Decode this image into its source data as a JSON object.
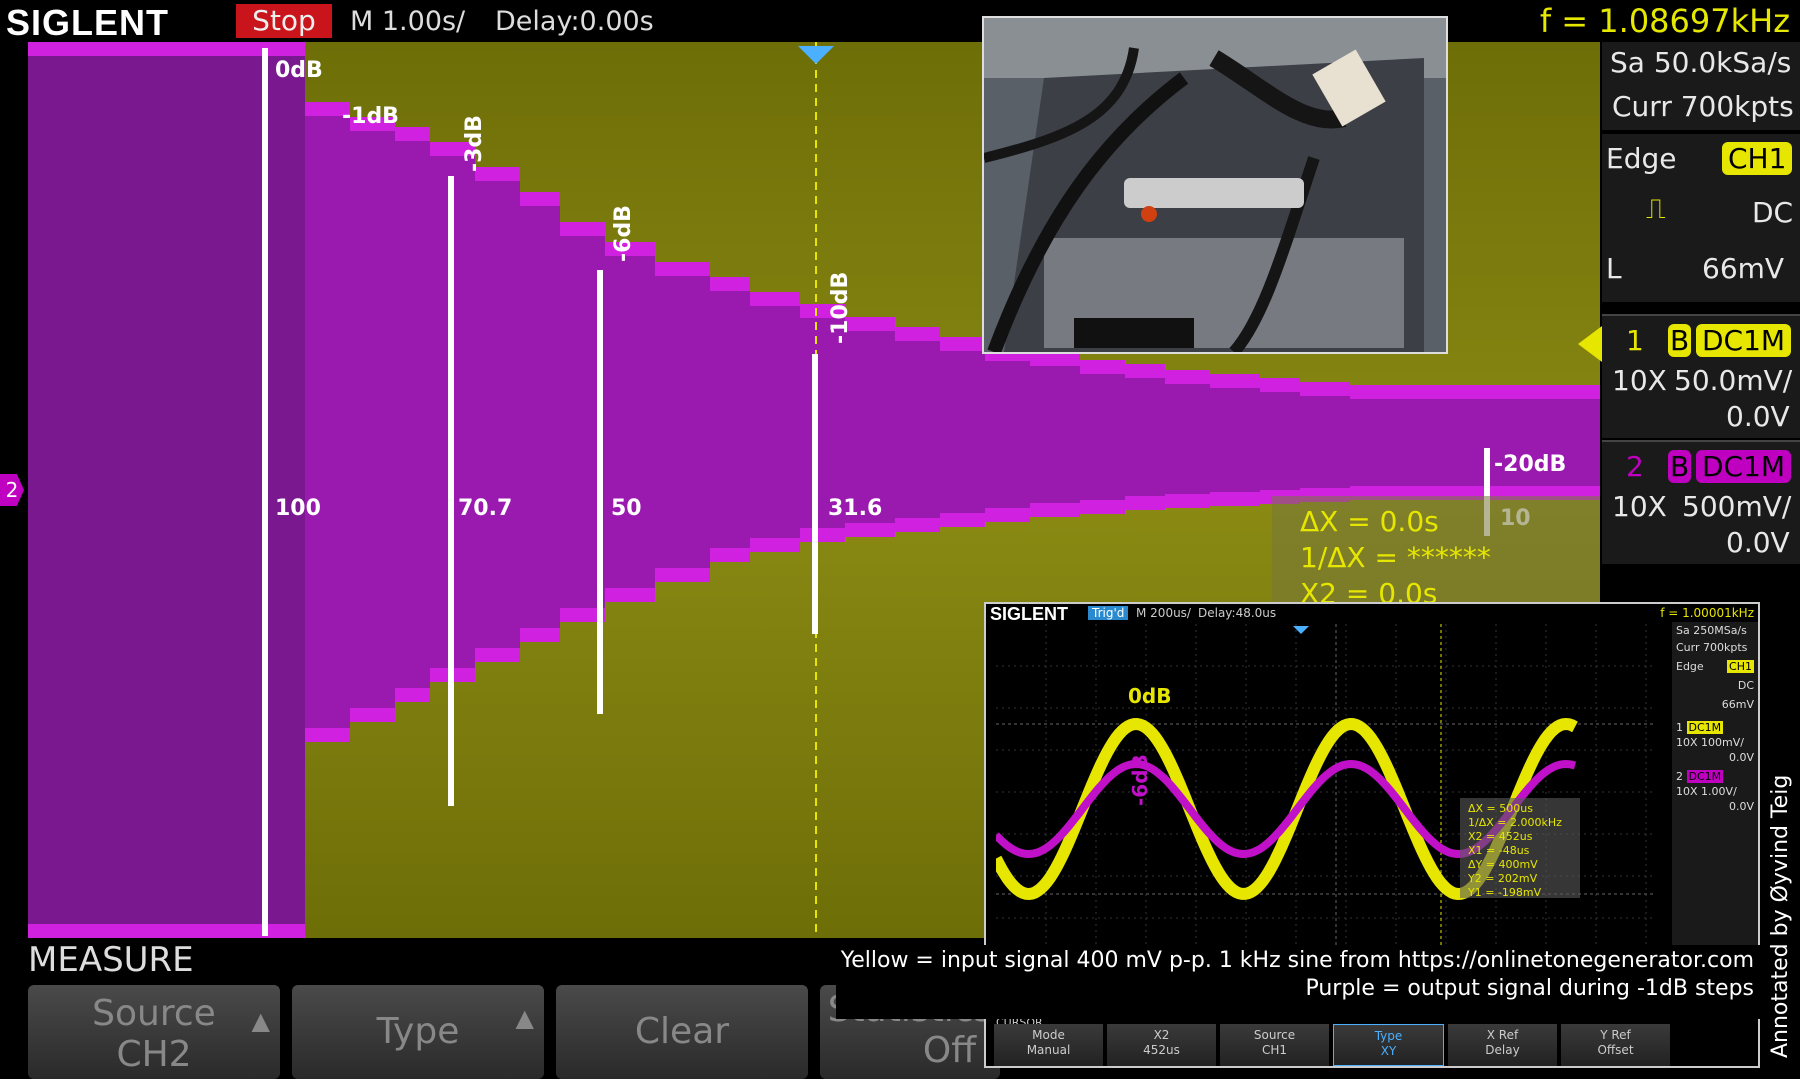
{
  "topbar": {
    "brand": "SIGLENT",
    "run_state": "Stop",
    "timebase": "M 1.00s/",
    "delay": "Delay:0.00s",
    "frequency": "f = 1.08697kHz"
  },
  "right_panel": {
    "sample_rate": "Sa 50.0kSa/s",
    "memory": "Curr 700kpts",
    "trigger_type": "Edge",
    "trigger_source": "CH1",
    "coupling": "DC",
    "level_label": "L",
    "level": "66mV",
    "ch1": {
      "num": "1",
      "bw": "B",
      "coupling": "DC1M",
      "probe": "10X",
      "scale": "50.0mV/",
      "offset": "0.0V"
    },
    "ch2": {
      "num": "2",
      "bw": "B",
      "coupling": "DC1M",
      "probe": "10X",
      "scale": "500mV/",
      "offset": "0.0V"
    }
  },
  "steps": [
    {
      "db": "0dB",
      "value": "100"
    },
    {
      "db": "-1dB",
      "value": ""
    },
    {
      "db": "-3dB",
      "value": "70.7"
    },
    {
      "db": "-6dB",
      "value": "50"
    },
    {
      "db": "-10dB",
      "value": "31.6"
    },
    {
      "db": "-20dB",
      "value": "10"
    }
  ],
  "ch2_marker": "2",
  "cursor_box": {
    "dx": "ΔX = 0.0s",
    "inv_dx": "1/ΔX = ******",
    "x2": "X2 = 0.0s"
  },
  "measure_label": "MEASURE",
  "softkeys": [
    {
      "title": "Source",
      "value": "CH2"
    },
    {
      "title": "Type",
      "value": ""
    },
    {
      "title": "Clear",
      "value": ""
    },
    {
      "title": "Statistics",
      "value": "Off"
    }
  ],
  "inset_scope": {
    "brand": "SIGLENT",
    "state": "Trig'd",
    "timebase": "M 200us/",
    "delay": "Delay:48.0us",
    "frequency": "f = 1.00001kHz",
    "sample_rate": "Sa 250MSa/s",
    "memory": "Curr 700kpts",
    "trigger_type": "Edge",
    "trigger_source": "CH1",
    "coupling": "DC",
    "level": "66mV",
    "ch1": {
      "num": "1",
      "bw": "B",
      "coupling": "DC1M",
      "probe": "10X",
      "scale": "100mV/",
      "offset": "0.0V"
    },
    "ch2": {
      "num": "2",
      "bw": "B",
      "coupling": "DC1M",
      "probe": "10X",
      "scale": "1.00V/",
      "offset": "0.0V"
    },
    "label_yellow": "0dB",
    "label_purple": "-6dB",
    "cursors": [
      "ΔX = 500us",
      "1/ΔX = 2.000kHz",
      "X2 = 452us",
      "X1 = -48us",
      "ΔY = 400mV",
      "Y2 = 202mV",
      "Y1 = -198mV"
    ],
    "menu_title": "CURSOR",
    "softkeys": [
      {
        "title": "Mode",
        "value": "Manual"
      },
      {
        "title": "X2",
        "value": "452us"
      },
      {
        "title": "Source",
        "value": "CH1"
      },
      {
        "title": "Type",
        "value": "XY"
      },
      {
        "title": "X Ref",
        "value": "Delay"
      },
      {
        "title": "Y Ref",
        "value": "Offset"
      }
    ]
  },
  "caption": {
    "line1": "Yellow = input signal 400 mV p-p. 1 kHz sine from https://onlinetonegenerator.com",
    "line2": "Purple = output signal during -1dB steps"
  },
  "credit": "Annotated by Øyvind Teig",
  "colors": {
    "yellow_trace": "#e6e600",
    "purple_trace": "#c010c8",
    "olive_bg": "#7a7a10"
  }
}
